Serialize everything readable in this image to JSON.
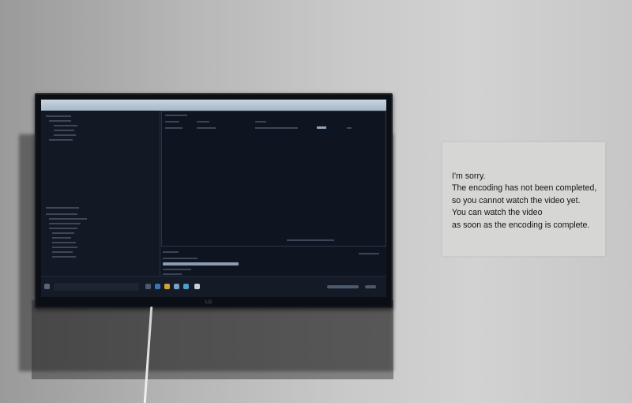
{
  "scene": {
    "description_tag": "photo of a wall-mounted monitor next to a printed notice",
    "monitor_brand": "LG"
  },
  "screen": {
    "left_tree": {
      "items": [
        "",
        "",
        "",
        "",
        ""
      ]
    },
    "file_panel": {
      "has_selected_row": true
    },
    "progress": {
      "fraction": 0.33
    }
  },
  "notice": {
    "lines": [
      "I'm sorry.",
      "The encoding has not been completed,",
      "so you cannot watch the video yet.",
      "You can watch the video",
      "as soon as the encoding is complete."
    ]
  }
}
